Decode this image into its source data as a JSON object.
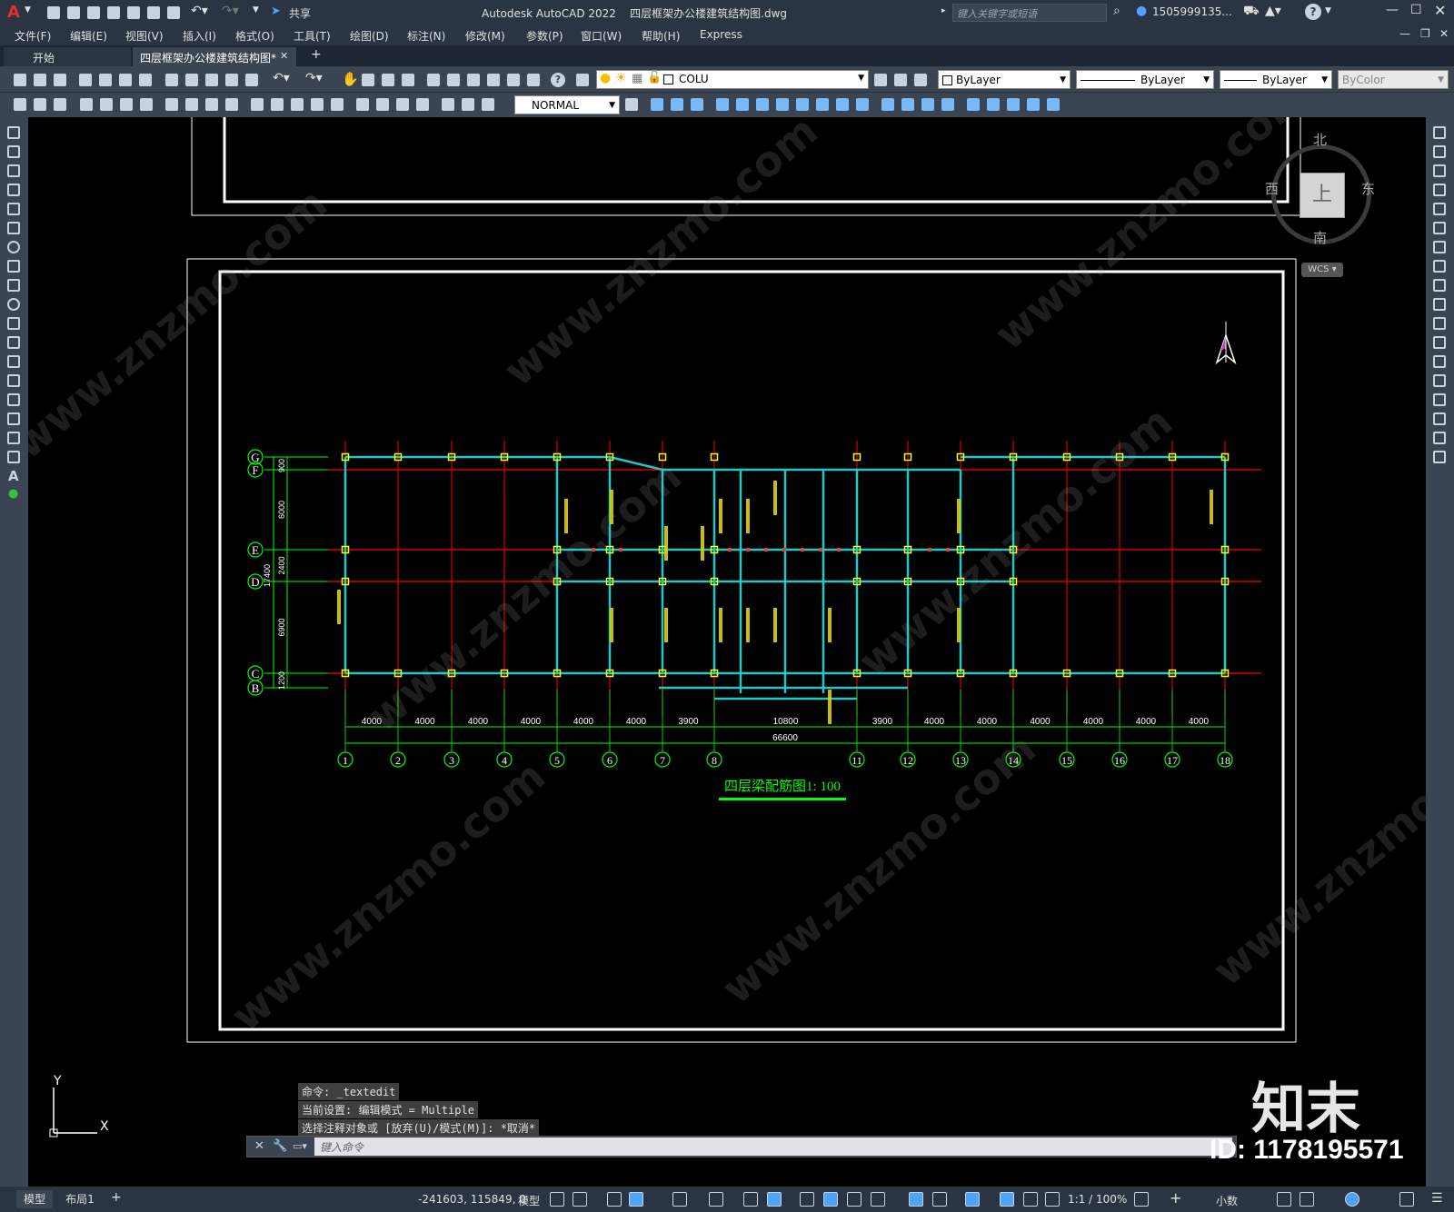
{
  "titlebar": {
    "app_logo": "A",
    "share_label": "共享",
    "title": "Autodesk AutoCAD 2022    四层框架办公楼建筑结构图.dwg",
    "search_placeholder": "键入关键字或短语",
    "user": "1505999135...",
    "help": "?"
  },
  "menu": [
    "文件(F)",
    "编辑(E)",
    "视图(V)",
    "插入(I)",
    "格式(O)",
    "工具(T)",
    "绘图(D)",
    "标注(N)",
    "修改(M)",
    "参数(P)",
    "窗口(W)",
    "帮助(H)",
    "Express"
  ],
  "tabs": {
    "start": "开始",
    "active": "四层框架办公楼建筑结构图*",
    "close": "✕",
    "add": "+"
  },
  "toolbar": {
    "layer_value": "COLU",
    "color_value": "ByLayer",
    "linetype_value": "ByLayer",
    "lineweight_value": "ByLayer",
    "plotstyle_value": "ByColor",
    "dimstyle_value": "NORMAL"
  },
  "viewcube": {
    "north": "北",
    "south": "南",
    "east": "东",
    "west": "西",
    "top": "上",
    "wcs": "WCS"
  },
  "drawing": {
    "row_labels": [
      "G",
      "F",
      "E",
      "D",
      "C",
      "B"
    ],
    "row_dims": [
      "900",
      "6000",
      "2400",
      "6900",
      "1200"
    ],
    "total_vertical": "17400",
    "column_labels": [
      "1",
      "2",
      "3",
      "4",
      "5",
      "6",
      "7",
      "8",
      "11",
      "12",
      "13",
      "14",
      "15",
      "16",
      "17",
      "18"
    ],
    "column_spacings": [
      "4000",
      "4000",
      "4000",
      "4000",
      "4000",
      "4000",
      "3900",
      "10800",
      "3900",
      "4000",
      "4000",
      "4000",
      "4000",
      "4000",
      "4000"
    ],
    "total_length": "66600",
    "title": "四层梁配筋图1: 100"
  },
  "ucs": {
    "x": "X",
    "y": "Y"
  },
  "commands": [
    "命令: _textedit",
    "当前设置: 编辑模式 = Multiple",
    "选择注释对象或 [放弃(U)/模式(M)]: *取消*"
  ],
  "command_placeholder": "键入命令",
  "status": {
    "tab_model": "模型",
    "tab_layout": "布局1",
    "add": "+",
    "coords": "-241603, 115849, 0",
    "mode": "模型",
    "scale": "1:1 / 100%",
    "units": "小数"
  },
  "watermark": {
    "logo": "知末",
    "id": "ID: 1178195571",
    "site": "www.znzmo.com"
  }
}
